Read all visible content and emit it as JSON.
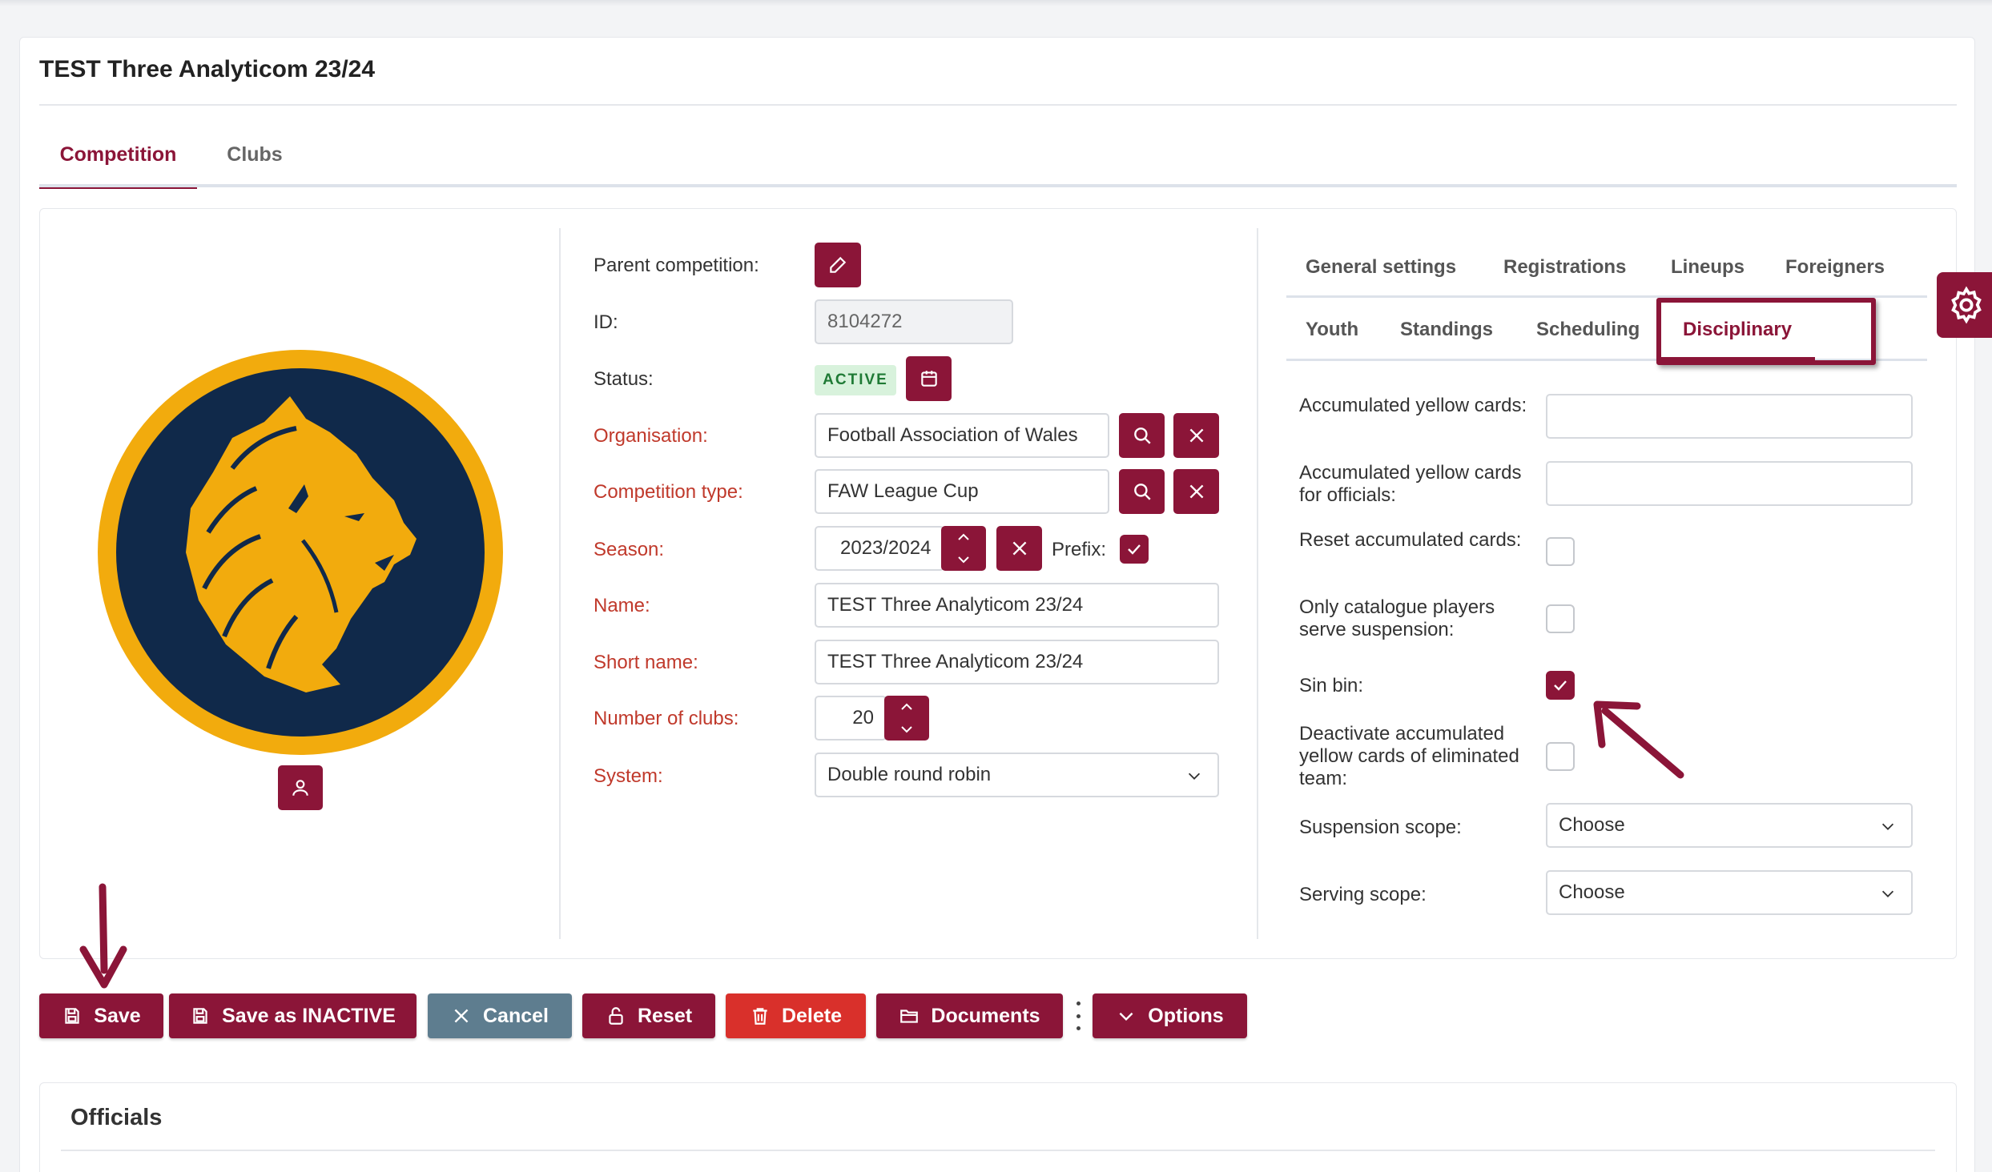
{
  "page": {
    "title": "TEST Three Analyticom 23/24",
    "accent_color": "#8b1538"
  },
  "main_tabs": [
    {
      "label": "Competition",
      "active": true
    },
    {
      "label": "Clubs",
      "active": false
    }
  ],
  "form": {
    "parent_competition_label": "Parent competition:",
    "id_label": "ID:",
    "id_value": "8104272",
    "status_label": "Status:",
    "status_value": "ACTIVE",
    "organisation_label": "Organisation:",
    "organisation_value": "Football Association of Wales",
    "competition_type_label": "Competition type:",
    "competition_type_value": "FAW League Cup",
    "season_label": "Season:",
    "season_value": "2023/2024",
    "prefix_label": "Prefix:",
    "prefix_checked": true,
    "name_label": "Name:",
    "name_value": "TEST Three Analyticom 23/24",
    "short_name_label": "Short name:",
    "short_name_value": "TEST Three Analyticom 23/24",
    "number_of_clubs_label": "Number of clubs:",
    "number_of_clubs_value": "20",
    "system_label": "System:",
    "system_value": "Double round robin"
  },
  "settings_tabs": {
    "row1": [
      "General settings",
      "Registrations",
      "Lineups",
      "Foreigners"
    ],
    "row2": [
      "Youth",
      "Standings",
      "Scheduling",
      "Disciplinary"
    ],
    "active": "Disciplinary"
  },
  "disciplinary": {
    "accumulated_yellow_label": "Accumulated yellow cards:",
    "accumulated_yellow_value": "",
    "accumulated_yellow_officials_label": "Accumulated yellow cards for officials:",
    "accumulated_yellow_officials_value": "",
    "reset_accumulated_label": "Reset accumulated cards:",
    "reset_accumulated_checked": false,
    "only_catalogue_label": "Only catalogue players serve suspension:",
    "only_catalogue_checked": false,
    "sin_bin_label": "Sin bin:",
    "sin_bin_checked": true,
    "deactivate_label": "Deactivate accumulated yellow cards of eliminated team:",
    "deactivate_checked": false,
    "suspension_scope_label": "Suspension scope:",
    "suspension_scope_value": "Choose",
    "serving_scope_label": "Serving scope:",
    "serving_scope_value": "Choose"
  },
  "actions": {
    "save": "Save",
    "save_inactive": "Save as INACTIVE",
    "cancel": "Cancel",
    "reset": "Reset",
    "delete": "Delete",
    "documents": "Documents",
    "options": "Options"
  },
  "officials": {
    "title": "Officials"
  },
  "icons": {
    "parent_edit": "pencil-icon",
    "status_calendar": "calendar-icon",
    "search": "search-icon",
    "clear": "close-icon",
    "logo_upload": "user-icon",
    "settings": "gear-icon"
  }
}
